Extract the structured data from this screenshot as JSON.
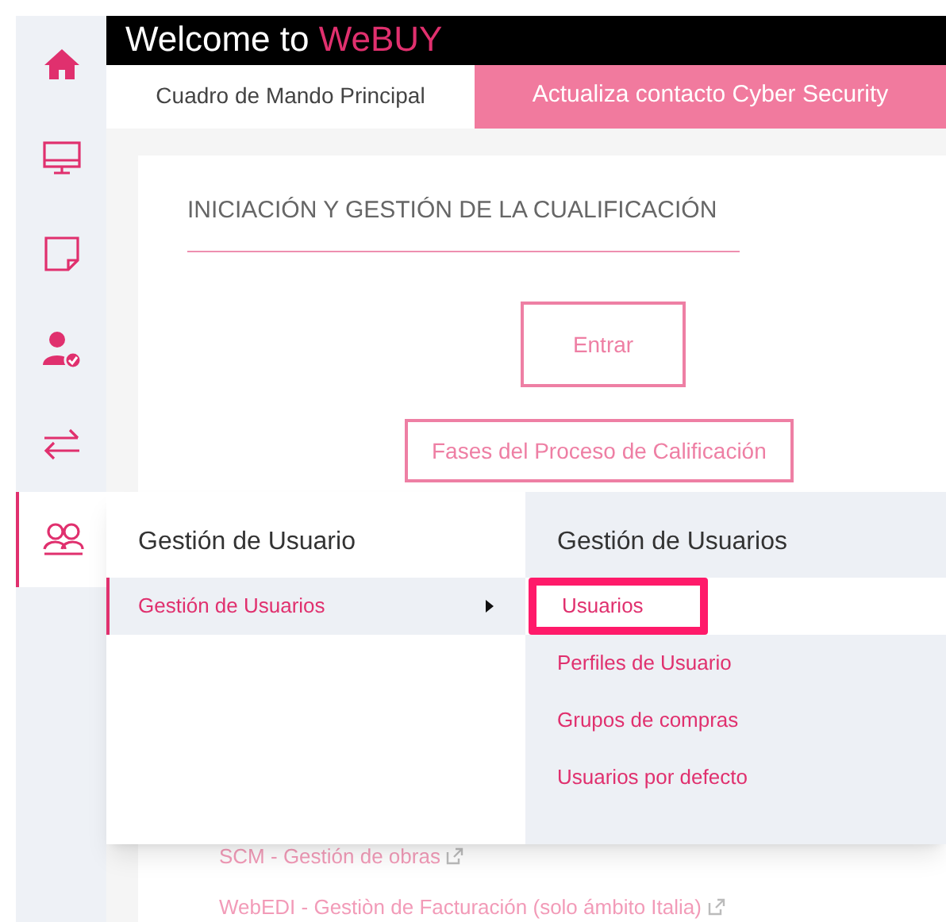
{
  "header": {
    "title": "Welcome to",
    "brand": "WeBUY"
  },
  "sidebar": {
    "items": [
      {
        "kind": "home",
        "selected": false
      },
      {
        "kind": "monitor",
        "selected": false
      },
      {
        "kind": "note",
        "selected": false
      },
      {
        "kind": "user-check",
        "selected": false
      },
      {
        "kind": "arrows",
        "selected": false
      },
      {
        "kind": "users",
        "selected": true
      }
    ]
  },
  "tabs": [
    {
      "label": "Cuadro de Mando Principal",
      "selected": true
    },
    {
      "label": "Actualiza contacto Cyber Security",
      "selected": false
    }
  ],
  "card": {
    "title": "INICIACIÓN Y GESTIÓN DE LA CUALIFICACIÓN",
    "buttons": [
      "Entrar",
      "Fases del Proceso de Calificación"
    ],
    "links": [
      "SCM - Gestión de obras",
      "WebEDI - Gestiòn de Facturación (solo ámbito Italia)"
    ]
  },
  "menu": {
    "title": "Gestión de Usuario",
    "items": [
      {
        "label": "Gestión de Usuarios",
        "selected": true,
        "has_submenu": true
      }
    ]
  },
  "submenu": {
    "title": "Gestión de Usuarios",
    "items": [
      {
        "label": "Usuarios",
        "selected": true,
        "highlighted": true
      },
      {
        "label": "Perfiles de Usuario",
        "selected": false,
        "highlighted": false
      },
      {
        "label": "Grupos de compras",
        "selected": false,
        "highlighted": false
      },
      {
        "label": "Usuarios por defecto",
        "selected": false,
        "highlighted": false
      }
    ]
  }
}
